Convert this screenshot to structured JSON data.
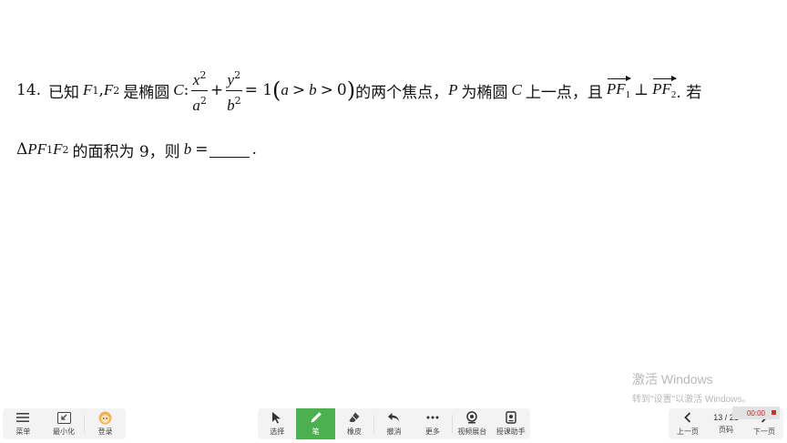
{
  "question": {
    "number": "14.",
    "t_known": "已知",
    "F": "F",
    "s1": "1",
    "s2": "2",
    "comma": ",",
    "t_is_ellipse": "是椭圆",
    "C": "C",
    "colon": ":",
    "x": "x",
    "y": "y",
    "a": "a",
    "b": "b",
    "sq": "2",
    "plus": "+",
    "eq1": "= 1",
    "lparen": "(",
    "gt": ">",
    "zero": "0",
    "rparen": ")",
    "t_two_foci": "的两个焦点，",
    "P": "P",
    "t_is_point": "为椭圆",
    "t_upper_point": "上一点，且",
    "PF": "PF",
    "perp": "⊥",
    "t_dot_if": ". 若",
    "delta": "Δ",
    "t_area": "的面积为 9，则",
    "eq": "=",
    "end": "."
  },
  "watermark": {
    "line1": "激活 Windows",
    "line2": "转到\"设置\"以激活 Windows。"
  },
  "toolbar": {
    "menu": "菜单",
    "minimize": "最小化",
    "login": "登录",
    "select": "选择",
    "pen": "笔",
    "eraser": "橡皮",
    "undo": "撤消",
    "more": "更多",
    "video_booth": "视频展台",
    "assistant": "授课助手",
    "prev": "上一页",
    "page": "页码",
    "next": "下一页",
    "page_indicator": "13 / 21",
    "timer": "00:00"
  },
  "colors": {
    "pen_active": "#4caf50",
    "timer_text": "#c62828"
  },
  "icons": [
    "menu-icon",
    "minimize-icon",
    "avatar-icon",
    "cursor-icon",
    "pen-icon",
    "eraser-icon",
    "undo-icon",
    "more-icon",
    "camera-icon",
    "assistant-icon",
    "chevron-left-icon",
    "chevron-right-icon",
    "stop-icon"
  ]
}
